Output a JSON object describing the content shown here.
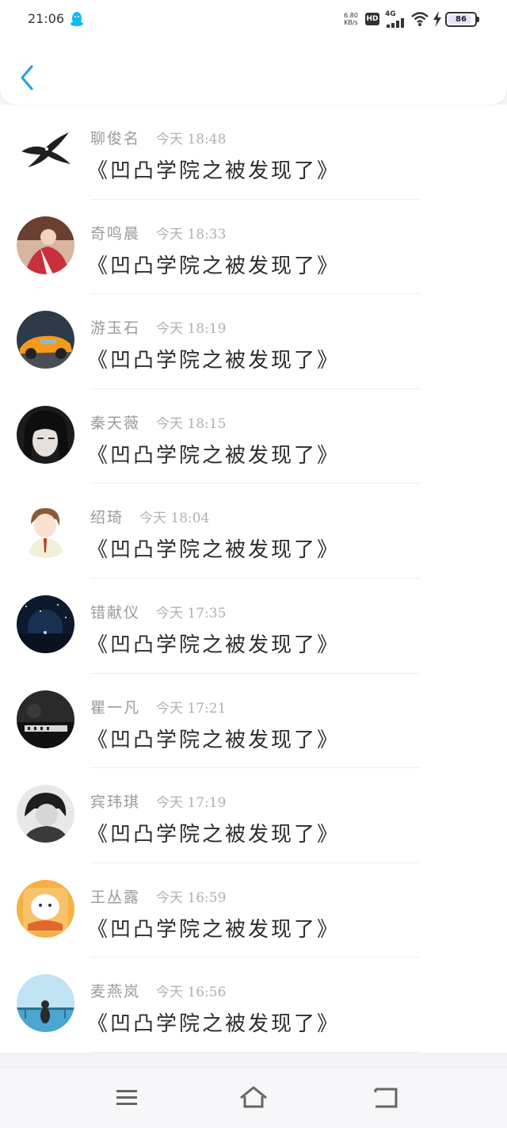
{
  "status_bar": {
    "time": "21:06",
    "net_speed": "6.80",
    "net_speed_unit": "KB/s",
    "hd_label": "HD",
    "network_type": "4G",
    "battery_level": "86",
    "battery_fraction": 0.86,
    "icons": [
      "qq-penguin-icon",
      "hd-icon",
      "signal-icon",
      "wifi-icon",
      "charging-bolt-icon",
      "battery-icon"
    ]
  },
  "header": {
    "back_icon": "chevron-left-icon",
    "accent_color": "#2aa0e8"
  },
  "messages": [
    {
      "name": "聊俊名",
      "time": "今天 18:48",
      "text": "《凹凸学院之被发现了》"
    },
    {
      "name": "奇鸣晨",
      "time": "今天 18:33",
      "text": "《凹凸学院之被发现了》"
    },
    {
      "name": "游玉石",
      "time": "今天 18:19",
      "text": "《凹凸学院之被发现了》"
    },
    {
      "name": "秦天薇",
      "time": "今天 18:15",
      "text": "《凹凸学院之被发现了》"
    },
    {
      "name": "绍琦",
      "time": "今天 18:04",
      "text": "《凹凸学院之被发现了》"
    },
    {
      "name": "错献仪",
      "time": "今天 17:35",
      "text": "《凹凸学院之被发现了》"
    },
    {
      "name": "瞿一凡",
      "time": "今天 17:21",
      "text": "《凹凸学院之被发现了》"
    },
    {
      "name": "宾玮琪",
      "time": "今天 17:19",
      "text": "《凹凸学院之被发现了》"
    },
    {
      "name": "王丛露",
      "time": "今天 16:59",
      "text": "《凹凸学院之被发现了》"
    },
    {
      "name": "麦燕岚",
      "time": "今天 16:56",
      "text": "《凹凸学院之被发现了》"
    }
  ],
  "nav_bar": {
    "icons": [
      "menu-icon",
      "home-icon",
      "back-icon"
    ]
  }
}
